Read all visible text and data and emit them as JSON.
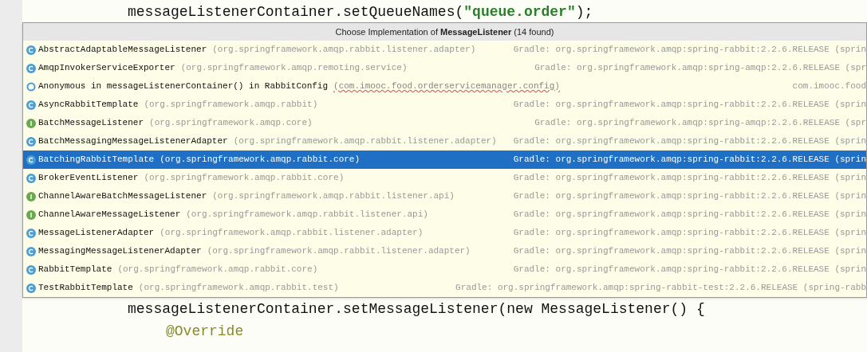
{
  "editor_lines_above": [
    {
      "segments": [
        {
          "kind": "code",
          "text": "messageListenerContainer.setQueueNames("
        },
        {
          "kind": "string",
          "text": "\"queue.order\""
        },
        {
          "kind": "code",
          "text": ");"
        }
      ]
    }
  ],
  "popup": {
    "title": "Choose Implementation of **MessageListener** (14 found)",
    "items": [
      {
        "kind": "class",
        "name": "AbstractAdaptableMessageListener",
        "package": "(org.springframework.amqp.rabbit.listener.adapter)",
        "location": "Gradle: org.springframework.amqp:spring-rabbit:2.2.6.RELEASE (sprin",
        "selected": false
      },
      {
        "kind": "class",
        "name": "AmqpInvokerServiceExporter",
        "package": "(org.springframework.amqp.remoting.service)",
        "location": "Gradle: org.springframework.amqp:spring-amqp:2.2.6.RELEASE (spr",
        "selected": false
      },
      {
        "kind": "anonymous",
        "name": "Anonymous in messageListenerContainer() in RabbitConfig",
        "package": "(com.imooc.food.orderservicemanager.config)",
        "location": "com.imooc.food",
        "selected": false
      },
      {
        "kind": "class",
        "name": "AsyncRabbitTemplate",
        "package": "(org.springframework.amqp.rabbit)",
        "location": "Gradle: org.springframework.amqp:spring-rabbit:2.2.6.RELEASE (sprin",
        "selected": false
      },
      {
        "kind": "interface",
        "name": "BatchMessageListener",
        "package": "(org.springframework.amqp.core)",
        "location": "Gradle: org.springframework.amqp:spring-amqp:2.2.6.RELEASE (spr",
        "selected": false
      },
      {
        "kind": "class",
        "name": "BatchMessagingMessageListenerAdapter",
        "package": "(org.springframework.amqp.rabbit.listener.adapter)",
        "location": "Gradle: org.springframework.amqp:spring-rabbit:2.2.6.RELEASE (sprin",
        "selected": false
      },
      {
        "kind": "class",
        "name": "BatchingRabbitTemplate",
        "package": "(org.springframework.amqp.rabbit.core)",
        "location": "Gradle: org.springframework.amqp:spring-rabbit:2.2.6.RELEASE (sprin",
        "selected": true
      },
      {
        "kind": "class",
        "name": "BrokerEventListener",
        "package": "(org.springframework.amqp.rabbit.core)",
        "location": "Gradle: org.springframework.amqp:spring-rabbit:2.2.6.RELEASE (sprin",
        "selected": false
      },
      {
        "kind": "interface",
        "name": "ChannelAwareBatchMessageListener",
        "package": "(org.springframework.amqp.rabbit.listener.api)",
        "location": "Gradle: org.springframework.amqp:spring-rabbit:2.2.6.RELEASE (sprin",
        "selected": false
      },
      {
        "kind": "interface",
        "name": "ChannelAwareMessageListener",
        "package": "(org.springframework.amqp.rabbit.listener.api)",
        "location": "Gradle: org.springframework.amqp:spring-rabbit:2.2.6.RELEASE (sprin",
        "selected": false
      },
      {
        "kind": "class",
        "name": "MessageListenerAdapter",
        "package": "(org.springframework.amqp.rabbit.listener.adapter)",
        "location": "Gradle: org.springframework.amqp:spring-rabbit:2.2.6.RELEASE (sprin",
        "selected": false
      },
      {
        "kind": "class",
        "name": "MessagingMessageListenerAdapter",
        "package": "(org.springframework.amqp.rabbit.listener.adapter)",
        "location": "Gradle: org.springframework.amqp:spring-rabbit:2.2.6.RELEASE (sprin",
        "selected": false
      },
      {
        "kind": "class",
        "name": "RabbitTemplate",
        "package": "(org.springframework.amqp.rabbit.core)",
        "location": "Gradle: org.springframework.amqp:spring-rabbit:2.2.6.RELEASE (sprin",
        "selected": false
      },
      {
        "kind": "class",
        "name": "TestRabbitTemplate",
        "package": "(org.springframework.amqp.rabbit.test)",
        "location": "Gradle: org.springframework.amqp:spring-rabbit-test:2.2.6.RELEASE (spring-rabb",
        "selected": false
      }
    ]
  },
  "editor_lines_below": [
    {
      "code": "messageListenerContainer.setMessageListener(new MessageListener() {",
      "kind": "code"
    },
    {
      "code": "@Override",
      "kind": "annotation"
    }
  ]
}
